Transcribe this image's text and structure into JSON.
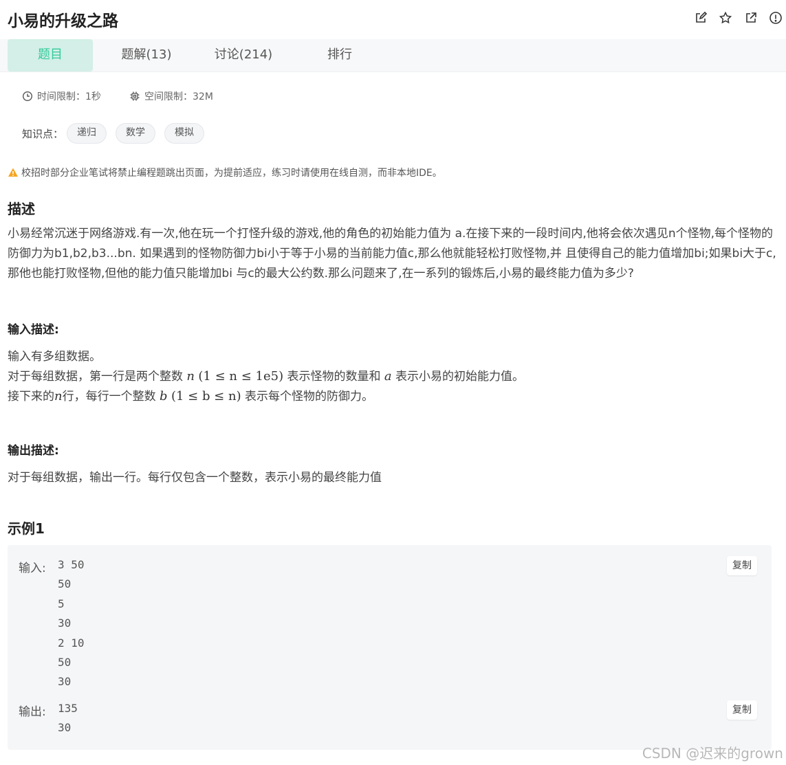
{
  "header": {
    "title": "小易的升级之路",
    "icons": [
      "edit-icon",
      "star-icon",
      "external-link-icon",
      "alert-icon"
    ]
  },
  "tabs": [
    {
      "label": "题目",
      "active": true
    },
    {
      "label": "题解(13)",
      "active": false
    },
    {
      "label": "讨论(214)",
      "active": false
    },
    {
      "label": "排行",
      "active": false
    }
  ],
  "limits": {
    "time": "时间限制：1秒",
    "space": "空间限制：32M"
  },
  "knowledge": {
    "label": "知识点：",
    "tags": [
      "递归",
      "数学",
      "模拟"
    ]
  },
  "warning": "校招时部分企业笔试将禁止编程题跳出页面，为提前适应，练习时请使用在线自测，而非本地IDE。",
  "description": {
    "heading": "描述",
    "text": "小易经常沉迷于网络游戏.有一次,他在玩一个打怪升级的游戏,他的角色的初始能力值为 a.在接下来的一段时间内,他将会依次遇见n个怪物,每个怪物的防御力为b1,b2,b3...bn. 如果遇到的怪物防御力bi小于等于小易的当前能力值c,那么他就能轻松打败怪物,并 且使得自己的能力值增加bi;如果bi大于c,那他也能打败怪物,但他的能力值只能增加bi 与c的最大公约数.那么问题来了,在一系列的锻炼后,小易的最终能力值为多少?"
  },
  "input_desc": {
    "heading": "输入描述:",
    "line1": "输入有多组数据。",
    "line2_pre": "对于每组数据，第一行是两个整数",
    "line2_math1": "n",
    "line2_math2": "(1 ≤ n ≤ 1e5)",
    "line2_mid": "表示怪物的数量和",
    "line2_math3": "a",
    "line2_post": "表示小易的初始能力值。",
    "line3_pre": "接下来的",
    "line3_math1": "n",
    "line3_mid": "行，每行一个整数",
    "line3_math2": "b",
    "line3_math3": "(1 ≤ b ≤ n)",
    "line3_post": "表示每个怪物的防御力。"
  },
  "output_desc": {
    "heading": "输出描述:",
    "text": "对于每组数据，输出一行。每行仅包含一个整数，表示小易的最终能力值"
  },
  "example": {
    "heading": "示例1",
    "input_label": "输入:",
    "input_lines": [
      "3 50",
      "50",
      "5",
      "30",
      "2 10",
      "50",
      "30"
    ],
    "output_label": "输出:",
    "output_lines": [
      "135",
      "30"
    ],
    "copy_label": "复制"
  },
  "watermark": "CSDN @迟来的grown",
  "colors": {
    "accent": "#32ca99",
    "active_tab_bg": "#d3efe7",
    "warning": "#f5a623"
  }
}
